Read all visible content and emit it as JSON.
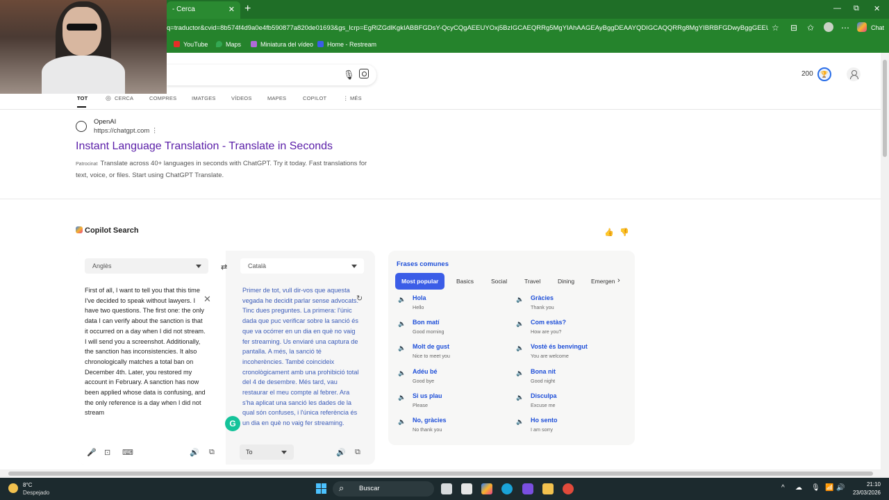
{
  "browser": {
    "tab_title": "- Cerca",
    "tab_close": "✕",
    "new_tab": "+",
    "url": "q=traductor&cvid=8b574f4d9a0e4fb590877a820de01693&gs_lcrp=EgRlZGdlKgkIABBFGDsY-QcyCQgAEEUYOxj5BzIGCAEQRRg5MgYIAhAAGEAyBggDEAAYQDIGCAQQRRg8MgYIBRBFGDwyBggGEEUYPDIGCAc...",
    "chat_label": "Chat",
    "bookmarks": [
      "YouTube",
      "Maps",
      "Miniatura del vídeo",
      "Home - Restream"
    ],
    "window_controls": {
      "minimize": "—",
      "maximize": "⧉",
      "close": "✕"
    }
  },
  "header": {
    "points": "200"
  },
  "nav_tabs": [
    "TOT",
    "CERCA",
    "COMPRES",
    "IMATGES",
    "VÍDEOS",
    "MAPES",
    "COPILOT",
    "⋮ MÉS"
  ],
  "ad": {
    "site_name": "OpenAI",
    "url": "https://chatgpt.com ⋮",
    "title": "Instant Language Translation - Translate in Seconds",
    "sponsored_label": "Patrocinat",
    "description": "Translate across 40+ languages in seconds with ChatGPT. Try it today. Fast translations for text, voice, or files. Start using ChatGPT Translate."
  },
  "copilot": {
    "title": "Copilot Search",
    "thumbs_up": "👍",
    "thumbs_down": "👎"
  },
  "translator": {
    "source_language": "Anglès",
    "target_language": "Català",
    "swap_icon": "⇄",
    "source_text": "First of all, I want to tell you that this time I've decided to speak without lawyers. I have two questions. The first one: the only data I can verify about the sanction is that it occurred on a day when I did not stream. I will send you a screenshot. Additionally, the sanction has inconsistencies. It also chronologically matches a total ban on December 4th. Later, you restored my account in February. A sanction has now been applied whose data is confusing, and the only reference is a day when I did not stream",
    "target_text": "Primer de tot, vull dir-vos que aquesta vegada he decidit parlar sense advocats. Tinc dues preguntes. La primera: l'únic dada que puc verificar sobre la sanció és que va ocórrer en un dia en què no vaig fer streaming. Us enviaré una captura de pantalla. A més, la sanció té incoherències. També coincideix cronològicament amb una prohibició total del 4 de desembre. Més tard, vau restaurar el meu compte al febrer. Ara s'ha aplicat una sanció les dades de la qual són confuses, i l'única referència és un dia en què no vaig fer streaming.",
    "clear_icon": "✕",
    "refresh_icon": "↻",
    "grammarly": "G",
    "tone_label": "To"
  },
  "phrases": {
    "title": "Frases comunes",
    "categories": [
      "Most popular",
      "Basics",
      "Social",
      "Travel",
      "Dining",
      "Emergen"
    ],
    "items": [
      {
        "word": "Hola",
        "gloss": "Hello"
      },
      {
        "word": "Gràcies",
        "gloss": "Thank you"
      },
      {
        "word": "Bon matí",
        "gloss": "Good morning"
      },
      {
        "word": "Com estàs?",
        "gloss": "How are you?"
      },
      {
        "word": "Molt de gust",
        "gloss": "Nice to meet you"
      },
      {
        "word": "Vostè és benvingut",
        "gloss": "You are welcome"
      },
      {
        "word": "Adéu bé",
        "gloss": "Good bye"
      },
      {
        "word": "Bona nit",
        "gloss": "Good night"
      },
      {
        "word": "Si us plau",
        "gloss": "Please"
      },
      {
        "word": "Disculpa",
        "gloss": "Excuse me"
      },
      {
        "word": "No, gràcies",
        "gloss": "No thank you"
      },
      {
        "word": "Ho sento",
        "gloss": "I am sorry"
      }
    ]
  },
  "taskbar": {
    "temperature": "8°C",
    "condition": "Despejado",
    "search_label": "Buscar",
    "time": "21:10",
    "date": "23/03/2026"
  }
}
